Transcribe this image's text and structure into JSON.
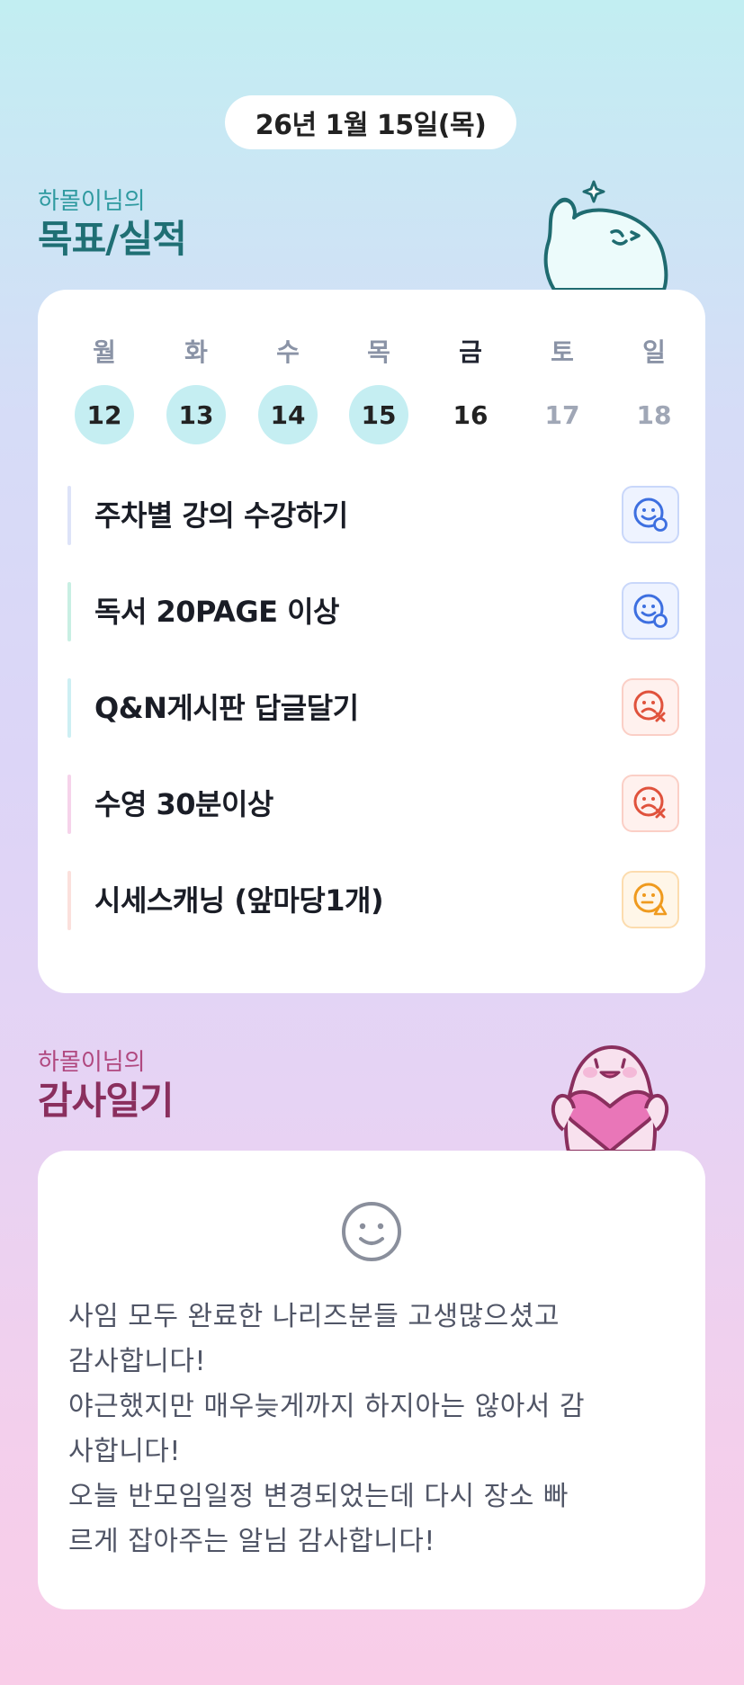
{
  "date": "26년 1월 15일(목)",
  "goals_section": {
    "subtitle": "하몰이님의",
    "title": "목표/실적",
    "weekdays": [
      "월",
      "화",
      "수",
      "목",
      "금",
      "토",
      "일"
    ],
    "days": [
      "12",
      "13",
      "14",
      "15",
      "16",
      "17",
      "18"
    ],
    "goals": [
      {
        "label": "주차별 강의 수강하기",
        "status": "done",
        "bar_color": "#dde3f8",
        "icon": "smile-check-icon"
      },
      {
        "label": "독서 20PAGE 이상",
        "status": "done",
        "bar_color": "#c8efe3",
        "icon": "smile-check-icon"
      },
      {
        "label": "Q&N게시판 답글달기",
        "status": "fail",
        "bar_color": "#cdeff3",
        "icon": "sad-x-icon"
      },
      {
        "label": "수영 30분이상",
        "status": "fail",
        "bar_color": "#f6d3ea",
        "icon": "sad-x-icon"
      },
      {
        "label": "시세스캐닝 (앞마당1개)",
        "status": "partial",
        "bar_color": "#fbe0dc",
        "icon": "neutral-triangle-icon"
      }
    ]
  },
  "diary_section": {
    "subtitle": "하몰이님의",
    "title": "감사일기",
    "icon": "smiley-face-icon",
    "lines": [
      "사임 모두 완료한 나리즈분들 고생많으셨고",
      "감사합니다!",
      "야근했지만 매우늦게까지 하지아는 않아서 감",
      "사합니다!",
      "오늘 반모임일정 변경되었는데 다시 장소 빠",
      "르게 잡아주는 알님 감사합니다!"
    ]
  },
  "colors": {
    "goals_title": "#1f6f74",
    "goals_subtitle": "#2f9aa0",
    "diary_title": "#8a2f5e",
    "diary_subtitle": "#b0487f",
    "done": "#3d6fe0",
    "fail": "#e0523c",
    "partial": "#ef9a1e"
  }
}
